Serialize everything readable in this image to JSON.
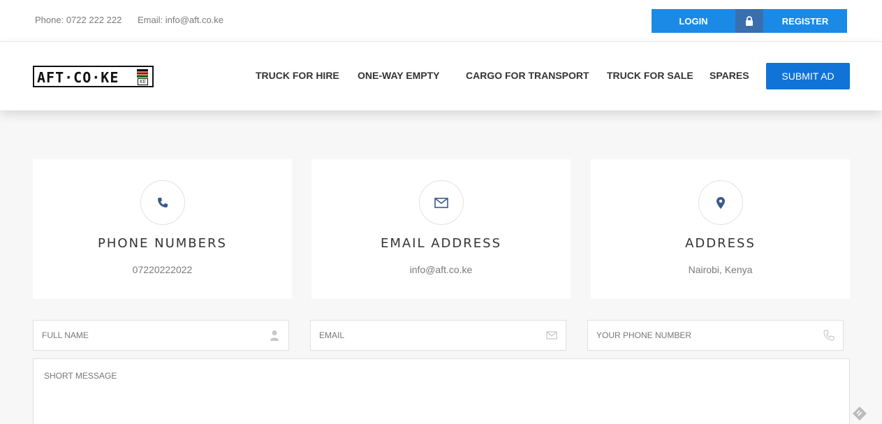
{
  "topbar": {
    "phone": "Phone: 0722 222 222",
    "email": "Email: info@aft.co.ke",
    "login_label": "LOGIN",
    "lock_icon": "lock-icon",
    "register_label": "REGISTER"
  },
  "header": {
    "logo_text": "AFT·CO·KE",
    "logo_badge": "KE",
    "nav": [
      "TRUCK FOR HIRE",
      "ONE-WAY EMPTY",
      "CARGO FOR TRANSPORT",
      "TRUCK FOR SALE",
      "SPARES"
    ],
    "submit_label": "SUBMIT AD"
  },
  "cards": [
    {
      "icon": "phone-icon",
      "title": "PHONE NUMBERS",
      "value": "07220222022"
    },
    {
      "icon": "envelope-icon",
      "title": "EMAIL ADDRESS",
      "value": "info@aft.co.ke"
    },
    {
      "icon": "map-marker-icon",
      "title": "ADDRESS",
      "value": "Nairobi, Kenya"
    }
  ],
  "form": {
    "full_name_placeholder": "FULL NAME",
    "email_placeholder": "EMAIL",
    "phone_placeholder": "YOUR PHONE NUMBER",
    "message_placeholder": "SHORT MESSAGE"
  },
  "colors": {
    "accent": "#1b8ae6",
    "lock_bg": "#3a6fae",
    "submit_bg": "#1073d8",
    "icon_blue": "#3b5a8c"
  }
}
